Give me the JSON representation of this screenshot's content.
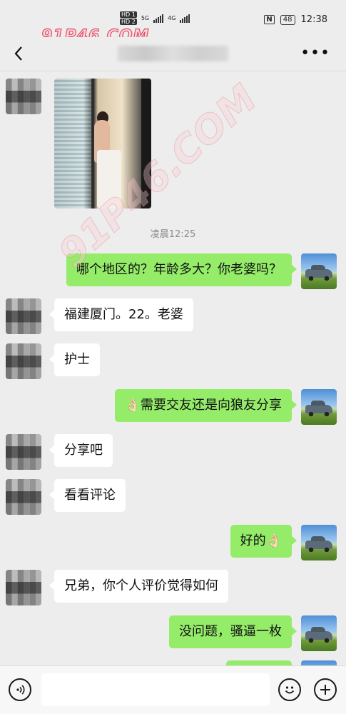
{
  "status_bar": {
    "sim1": "HD 1",
    "sim2": "HD 2",
    "network1": "5G",
    "network2": "4G",
    "nfc": "N",
    "battery": "48",
    "time": "12:38"
  },
  "watermark": "91P46.COM",
  "header": {
    "more_icon": "more-dots-icon"
  },
  "messages": {
    "timestamp": "凌晨12:25",
    "m1": "哪个地区的？年龄多大？你老婆吗？",
    "m2": "福建厦门。22。老婆",
    "m3": "护士",
    "m4": "👌🏻需要交友还是向狼友分享",
    "m5": "分享吧",
    "m6": "看看评论",
    "m7": "好的👌🏻",
    "m8": "兄弟，你个人评价觉得如何",
    "m9": "没问题，骚逼一枚"
  },
  "input": {
    "voice_icon": "voice-icon",
    "emoji_icon": "emoji-icon",
    "plus_icon": "plus-icon"
  },
  "colors": {
    "background": "#ededed",
    "sent_bubble": "#95ec69",
    "received_bubble": "#ffffff"
  }
}
